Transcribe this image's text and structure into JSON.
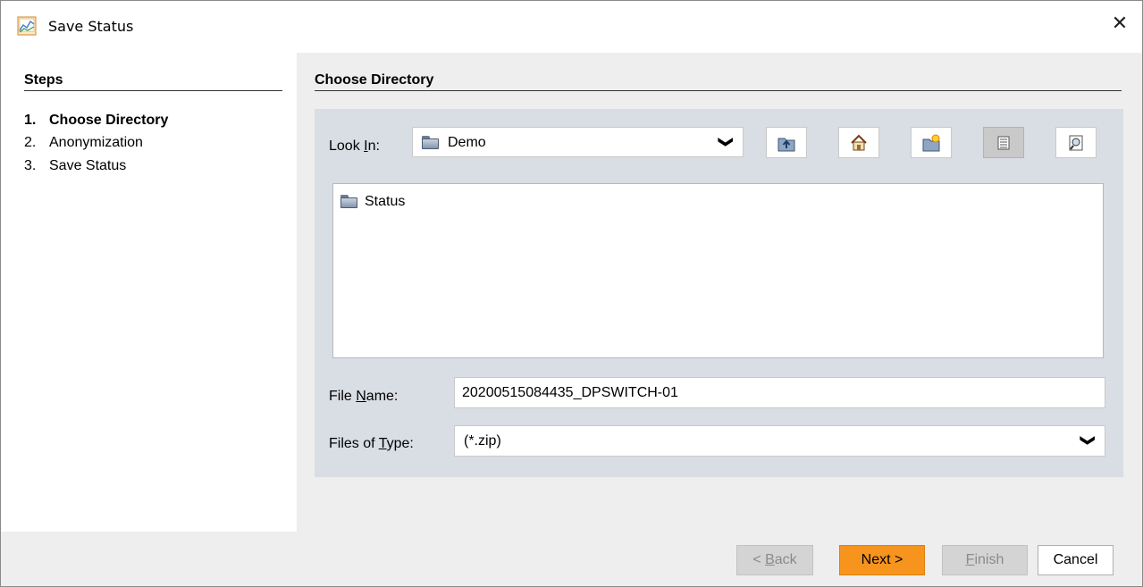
{
  "window": {
    "title": "Save Status",
    "close_glyph": "✕",
    "app_icon": "chart-icon"
  },
  "steps": {
    "header": "Steps",
    "items": [
      {
        "num": "1.",
        "label": "Choose Directory",
        "current": true
      },
      {
        "num": "2.",
        "label": "Anonymization",
        "current": false
      },
      {
        "num": "3.",
        "label": "Save Status",
        "current": false
      }
    ]
  },
  "main": {
    "header": "Choose Directory",
    "look_in": {
      "label_pre": "Look ",
      "label_mnemonic": "I",
      "label_post": "n:",
      "value": "Demo",
      "icon": "folder-icon"
    },
    "toolbar": [
      {
        "name": "up-one-level-button",
        "icon": "up-folder-icon",
        "active": false
      },
      {
        "name": "home-button",
        "icon": "home-icon",
        "active": false
      },
      {
        "name": "new-folder-button",
        "icon": "new-folder-icon",
        "active": false
      },
      {
        "name": "list-view-button",
        "icon": "list-icon",
        "active": true
      },
      {
        "name": "details-view-button",
        "icon": "details-icon",
        "active": false
      }
    ],
    "files": [
      {
        "name": "Status",
        "icon": "folder-icon"
      }
    ],
    "file_name": {
      "label_pre": "File ",
      "label_mnemonic": "N",
      "label_post": "ame:",
      "value": "20200515084435_DPSWITCH-01"
    },
    "file_type": {
      "label_pre": "Files of ",
      "label_mnemonic": "T",
      "label_post": "ype:",
      "value": "(*.zip)"
    }
  },
  "buttons": {
    "back": {
      "pre": "< ",
      "mnemonic": "B",
      "post": "ack"
    },
    "next": "Next >",
    "finish": {
      "mnemonic": "F",
      "post": "inish"
    },
    "cancel": "Cancel"
  },
  "colors": {
    "accent": "#f7941d",
    "chooser_bg": "#d9dde4",
    "content_bg": "#eeeeee"
  }
}
